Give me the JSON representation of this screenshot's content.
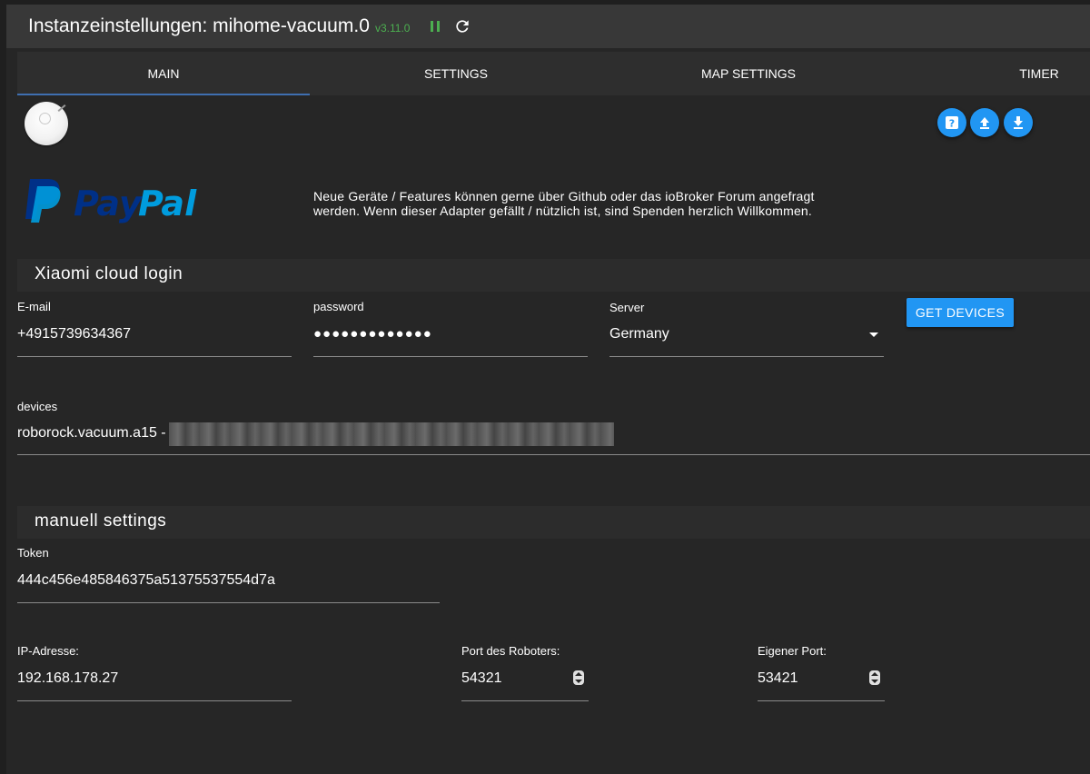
{
  "window": {
    "title": "Instanzeinstellungen: mihome-vacuum.0",
    "version": "v3.11.0"
  },
  "icons": {
    "pause": "pause-icon",
    "reload": "reload-icon",
    "help": "help-icon",
    "upload": "upload-icon",
    "download": "download-icon",
    "robot": "robot-vacuum-image",
    "dropdown": "dropdown-arrow-icon",
    "spinner": "number-spinner-icon"
  },
  "colors": {
    "accent": "#2196f3",
    "version_green": "#4caf50",
    "tab_indicator": "#3f6fb0",
    "background": "#262626",
    "paypal_dark": "#003087",
    "paypal_light": "#009cde"
  },
  "tabs": [
    {
      "label": "MAIN",
      "active": true
    },
    {
      "label": "SETTINGS",
      "active": false
    },
    {
      "label": "MAP SETTINGS",
      "active": false
    },
    {
      "label": "TIMER",
      "active": false
    }
  ],
  "paypal": {
    "logo_text_pay": "Pay",
    "logo_text_pal": "Pal",
    "text": "Neue Geräte / Features können gerne über Github oder das ioBroker Forum angefragt werden. Wenn dieser Adapter gefällt / nützlich ist, sind Spenden herzlich Willkommen."
  },
  "cloud_login": {
    "title": "Xiaomi cloud login",
    "email_label": "E-mail",
    "email_value": "+4915739634367",
    "password_label": "password",
    "password_value": "●●●●●●●●●●●●●",
    "server_label": "Server",
    "server_value": "Germany",
    "get_devices_label": "GET DEVICES",
    "devices_label": "devices",
    "devices_value": "roborock.vacuum.a15 -"
  },
  "manual": {
    "title": "manuell settings",
    "token_label": "Token",
    "token_value": "444c456e485846375a51375537554d7a",
    "ip_label": "IP-Adresse:",
    "ip_value": "192.168.178.27",
    "robot_port_label": "Port des Roboters:",
    "robot_port_value": "54321",
    "own_port_label": "Eigener Port:",
    "own_port_value": "53421"
  }
}
